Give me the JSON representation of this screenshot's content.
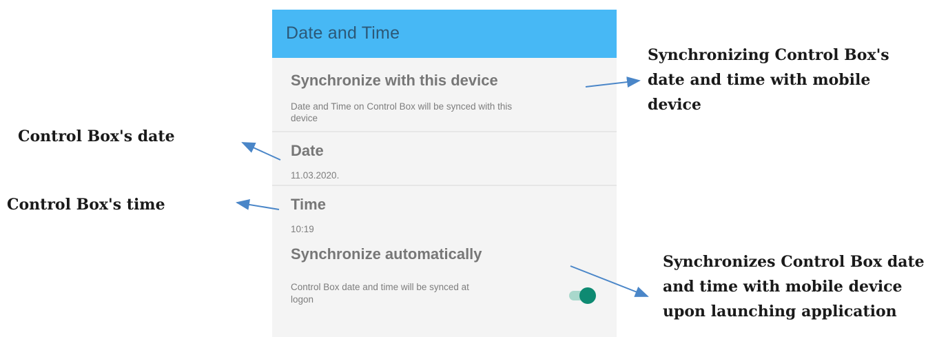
{
  "app_bar": {
    "title": "Date and Time",
    "color": "#47b8f5"
  },
  "settings": [
    {
      "title": "Synchronize with this device",
      "summary": "Date and Time on Control Box will be synced with this",
      "summary_line2": "device"
    },
    {
      "title": "Date",
      "summary": "11.03.2020."
    },
    {
      "title": "Time",
      "summary": "10:19"
    },
    {
      "title": "Synchronize automatically",
      "summary": "Control Box date and time will be synced at",
      "summary_line2": "logon",
      "toggle_on": true,
      "toggle_color": "#0e8a72"
    }
  ],
  "annotations": {
    "sync_device": [
      "Synchronizing Control Box's",
      "date and time with mobile",
      "device"
    ],
    "date": "Control Box's date",
    "time": "Control Box's time",
    "sync_auto": [
      "Synchronizes Control Box date",
      "and time with mobile device",
      "upon launching application"
    ],
    "arrow_color": "#4a86c8"
  }
}
